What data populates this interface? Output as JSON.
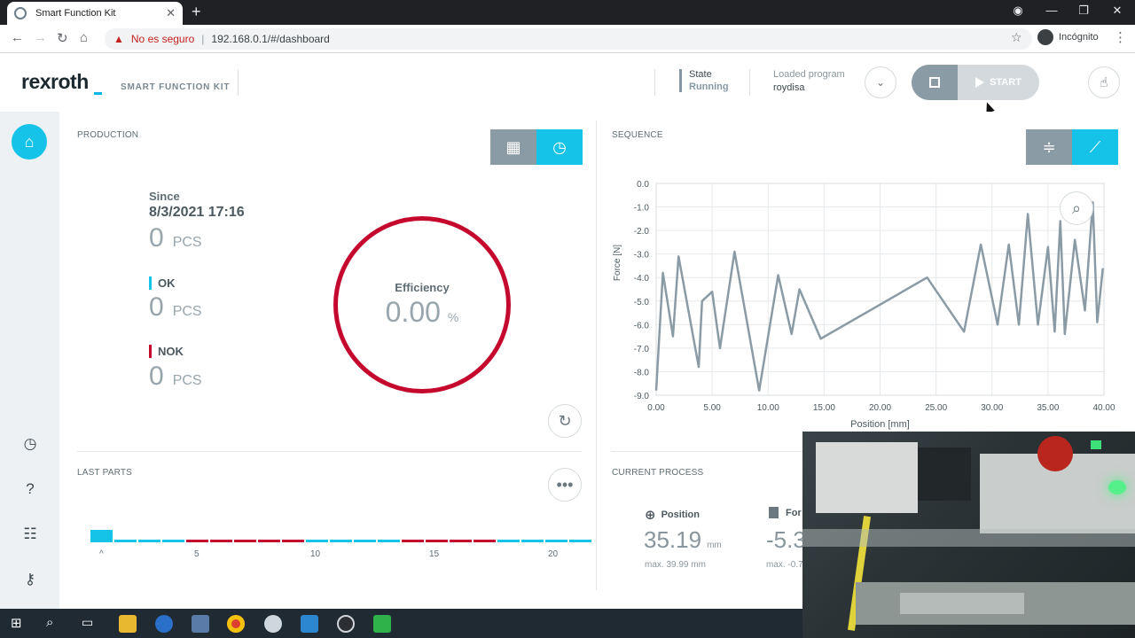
{
  "browser": {
    "tab_title": "Smart Function Kit",
    "security_label": "No es seguro",
    "url": "192.168.0.1/#/dashboard",
    "incognito_label": "Incógnito"
  },
  "header": {
    "logo": "rexroth",
    "product": "SMART FUNCTION KIT",
    "state_label": "State",
    "state_value": "Running",
    "program_label": "Loaded program",
    "program_value": "roydisa",
    "start_label": "START"
  },
  "production": {
    "title": "PRODUCTION",
    "since_label": "Since",
    "since_date": "8/3/2021 17:16",
    "total": "0",
    "unit": "PCS",
    "ok_label": "OK",
    "ok_count": "0",
    "nok_label": "NOK",
    "nok_count": "0",
    "efficiency_label": "Efficiency",
    "efficiency_value": "0.00",
    "efficiency_unit": "%"
  },
  "last_parts": {
    "title": "LAST PARTS",
    "results": [
      "ok",
      "ok",
      "ok",
      "ok",
      "nok",
      "nok",
      "nok",
      "nok",
      "nok",
      "ok",
      "ok",
      "ok",
      "ok",
      "nok",
      "nok",
      "nok",
      "nok",
      "ok",
      "ok",
      "ok",
      "ok"
    ],
    "ticks": [
      "^",
      "5",
      "10",
      "15",
      "20"
    ]
  },
  "sequence": {
    "title": "SEQUENCE"
  },
  "chart_data": {
    "type": "line",
    "xlabel": "Position [mm]",
    "ylabel": "Force [N]",
    "xlim": [
      0,
      40
    ],
    "ylim": [
      -9,
      0
    ],
    "xticks": [
      "0.00",
      "5.00",
      "10.00",
      "15.00",
      "20.00",
      "25.00",
      "30.00",
      "35.00",
      "40.00"
    ],
    "yticks": [
      "0.0",
      "-1.0",
      "-2.0",
      "-3.0",
      "-4.0",
      "-5.0",
      "-6.0",
      "-7.0",
      "-8.0",
      "-9.0"
    ],
    "grid": true,
    "series": [
      {
        "color": "#8b9ba5",
        "x": [
          0.0,
          0.6,
          1.5,
          2.0,
          3.8,
          4.1,
          5.0,
          5.7,
          7.0,
          9.2,
          10.9,
          12.1,
          12.8,
          14.7,
          24.2,
          27.5,
          29.0,
          30.5,
          31.5,
          32.4,
          33.2,
          34.1,
          35.0,
          35.6,
          36.1,
          36.5,
          37.4,
          38.3,
          39.0,
          39.4,
          39.9
        ],
        "y": [
          -8.8,
          -3.8,
          -6.5,
          -3.1,
          -7.8,
          -5.0,
          -4.6,
          -7.0,
          -2.9,
          -8.8,
          -3.9,
          -6.4,
          -4.5,
          -6.6,
          -4.0,
          -6.3,
          -2.6,
          -6.0,
          -2.6,
          -6.0,
          -1.3,
          -6.0,
          -2.7,
          -6.3,
          -1.6,
          -6.4,
          -2.4,
          -5.4,
          -0.8,
          -5.9,
          -3.6
        ]
      }
    ]
  },
  "current_process": {
    "title": "CURRENT PROCESS",
    "position_label": "Position",
    "position_value": "35.19",
    "position_unit": "mm",
    "position_max": "max. 39.99 mm",
    "force_label": "For",
    "force_value": "-5.3",
    "force_max": "max. -0.7"
  },
  "colors": {
    "accent": "#15c3e8",
    "nok": "#c4082e",
    "grey": "#8b9ba5"
  }
}
